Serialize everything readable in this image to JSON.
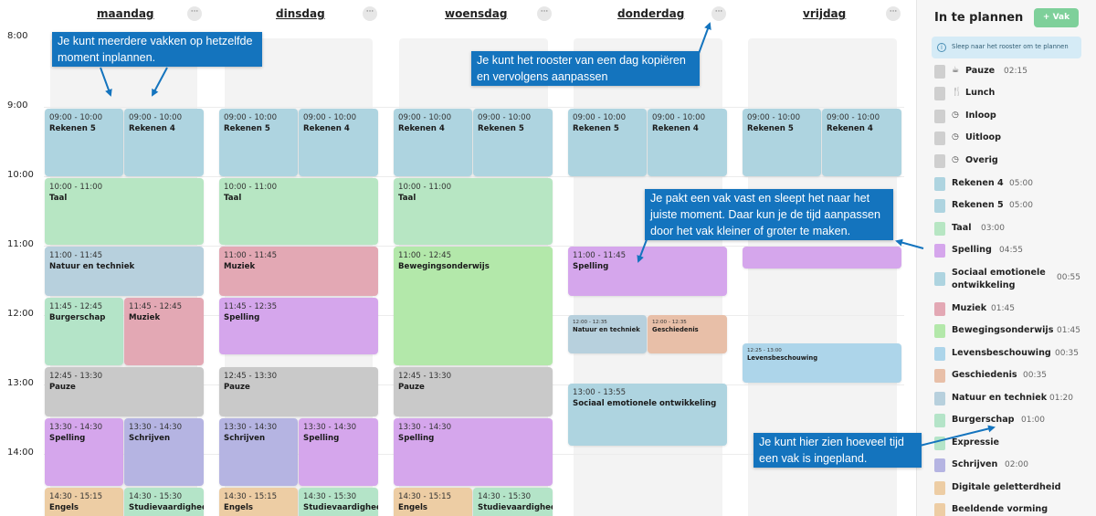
{
  "times": [
    "8:00",
    "9:00",
    "10:00",
    "11:00",
    "12:00",
    "13:00",
    "14:00"
  ],
  "days": [
    {
      "name": "maandag",
      "menu": "···"
    },
    {
      "name": "dinsdag",
      "menu": "···"
    },
    {
      "name": "woensdag",
      "menu": "···"
    },
    {
      "name": "donderdag",
      "menu": "···"
    },
    {
      "name": "vrijdag",
      "menu": "···"
    }
  ],
  "blocks": {
    "ma1": {
      "time": "09:00 - 10:00",
      "title": "Rekenen 5"
    },
    "ma2": {
      "time": "09:00 - 10:00",
      "title": "Rekenen 4"
    },
    "ma3": {
      "time": "10:00 - 11:00",
      "title": "Taal"
    },
    "ma4": {
      "time": "11:00 - 11:45",
      "title": "Natuur en techniek"
    },
    "ma5": {
      "time": "11:45 - 12:45",
      "title": "Burgerschap"
    },
    "ma6": {
      "time": "11:45 - 12:45",
      "title": "Muziek"
    },
    "ma7": {
      "time": "12:45 - 13:30",
      "title": "Pauze"
    },
    "ma8": {
      "time": "13:30 - 14:30",
      "title": "Spelling"
    },
    "ma9": {
      "time": "13:30 - 14:30",
      "title": "Schrijven"
    },
    "ma10": {
      "time": "14:30 - 15:15",
      "title": "Engels"
    },
    "ma11": {
      "time": "14:30 - 15:30",
      "title": "Studievaardighed"
    },
    "di1": {
      "time": "09:00 - 10:00",
      "title": "Rekenen 5"
    },
    "di2": {
      "time": "09:00 - 10:00",
      "title": "Rekenen 4"
    },
    "di3": {
      "time": "10:00 - 11:00",
      "title": "Taal"
    },
    "di4": {
      "time": "11:00 - 11:45",
      "title": "Muziek"
    },
    "di5": {
      "time": "11:45 - 12:35",
      "title": "Spelling"
    },
    "di6": {
      "time": "12:45 - 13:30",
      "title": "Pauze"
    },
    "di7": {
      "time": "13:30 - 14:30",
      "title": "Schrijven"
    },
    "di8": {
      "time": "13:30 - 14:30",
      "title": "Spelling"
    },
    "di9": {
      "time": "14:30 - 15:15",
      "title": "Engels"
    },
    "di10": {
      "time": "14:30 - 15:30",
      "title": "Studievaardighed"
    },
    "wo1": {
      "time": "09:00 - 10:00",
      "title": "Rekenen 4"
    },
    "wo2": {
      "time": "09:00 - 10:00",
      "title": "Rekenen 5"
    },
    "wo3": {
      "time": "10:00 - 11:00",
      "title": "Taal"
    },
    "wo4": {
      "time": "11:00 - 12:45",
      "title": "Bewegingsonderwijs"
    },
    "wo5": {
      "time": "12:45 - 13:30",
      "title": "Pauze"
    },
    "wo6": {
      "time": "13:30 - 14:30",
      "title": "Spelling"
    },
    "wo7": {
      "time": "14:30 - 15:15",
      "title": "Engels"
    },
    "wo8": {
      "time": "14:30 - 15:30",
      "title": "Studievaardighed"
    },
    "do1": {
      "time": "09:00 - 10:00",
      "title": "Rekenen 5"
    },
    "do2": {
      "time": "09:00 - 10:00",
      "title": "Rekenen 4"
    },
    "do3": {
      "time": "11:00 - 11:45",
      "title": "Spelling"
    },
    "do4": {
      "time": "12:00 - 12:35",
      "title": "Natuur en techniek"
    },
    "do5": {
      "time": "12:00 - 12:35",
      "title": "Geschiedenis"
    },
    "do6": {
      "time": "13:00 - 13:55",
      "title": "Sociaal emotionele ontwikkeling"
    },
    "vr1": {
      "time": "09:00 - 10:00",
      "title": "Rekenen 5"
    },
    "vr2": {
      "time": "09:00 - 10:00",
      "title": "Rekenen 4"
    },
    "vr3": {
      "time": "12:25 - 13:00",
      "title": "Levensbeschouwing"
    }
  },
  "panel": {
    "title": "In te plannen",
    "add_button": "+ Vak",
    "info_icon": "i",
    "info": "Sleep naar het rooster om te plannen",
    "subjects": [
      {
        "name": "Pauze",
        "duration": "02:15",
        "icon": "☕",
        "color": "#cfcfcf"
      },
      {
        "name": "Lunch",
        "duration": "",
        "icon": "🍴",
        "color": "#cfcfcf"
      },
      {
        "name": "Inloop",
        "duration": "",
        "icon": "◷",
        "color": "#cfcfcf"
      },
      {
        "name": "Uitloop",
        "duration": "",
        "icon": "◷",
        "color": "#cfcfcf"
      },
      {
        "name": "Overig",
        "duration": "",
        "icon": "◷",
        "color": "#cfcfcf"
      },
      {
        "name": "Rekenen 4",
        "duration": "05:00",
        "icon": "",
        "color": "#aed4e0"
      },
      {
        "name": "Rekenen 5",
        "duration": "05:00",
        "icon": "",
        "color": "#aed4e0"
      },
      {
        "name": "Taal",
        "duration": "03:00",
        "icon": "",
        "color": "#b7e6c3"
      },
      {
        "name": "Spelling",
        "duration": "04:55",
        "icon": "",
        "color": "#d5a6ec"
      },
      {
        "name": "Sociaal emotionele ontwikkeling",
        "duration": "00:55",
        "icon": "",
        "color": "#aed4e0"
      },
      {
        "name": "Muziek",
        "duration": "01:45",
        "icon": "",
        "color": "#e3a8b4"
      },
      {
        "name": "Bewegingsonderwijs",
        "duration": "01:45",
        "icon": "",
        "color": "#b3e8aa"
      },
      {
        "name": "Levensbeschouwing",
        "duration": "00:35",
        "icon": "",
        "color": "#add5ea"
      },
      {
        "name": "Geschiedenis",
        "duration": "00:35",
        "icon": "",
        "color": "#e8bfa8"
      },
      {
        "name": "Natuur en techniek",
        "duration": "01:20",
        "icon": "",
        "color": "#b7d0dd"
      },
      {
        "name": "Burgerschap",
        "duration": "01:00",
        "icon": "",
        "color": "#b4e4c8"
      },
      {
        "name": "Expressie",
        "duration": "",
        "icon": "",
        "color": "#b4e4c8"
      },
      {
        "name": "Schrijven",
        "duration": "02:00",
        "icon": "",
        "color": "#b5b4e2"
      },
      {
        "name": "Digitale geletterdheid",
        "duration": "",
        "icon": "",
        "color": "#edcda4"
      },
      {
        "name": "Beeldende vorming",
        "duration": "",
        "icon": "",
        "color": "#edcda4"
      }
    ]
  },
  "callouts": {
    "multi": "Je kunt meerdere vakken op hetzelfde moment inplannen.",
    "copy": "Je kunt het rooster van een dag kopiëren en vervolgens aanpassen",
    "drag": "Je pakt een vak vast en sleept het naar het juiste moment. Daar kun je de tijd aanpassen door het vak kleiner of groter te maken.",
    "time": "Je kunt hier zien hoeveel tijd een vak is ingepland."
  },
  "colors": {
    "callout": "#1474be",
    "add_button": "#7ed09a"
  }
}
